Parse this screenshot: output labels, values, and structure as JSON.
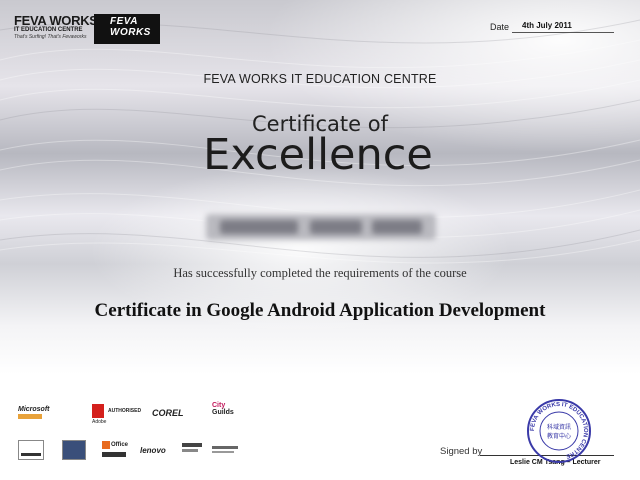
{
  "header": {
    "brand_name": "FEVA WORKS",
    "brand_sub": "IT EDUCATION CENTRE",
    "brand_tagline": "That's Surfing! That's Fevaworks",
    "brand_box_text": "FEVA WORKS"
  },
  "date": {
    "label": "Date",
    "value": "4th July 2011"
  },
  "certificate": {
    "centre_name": "FEVA WORKS IT EDUCATION CENTRE",
    "title_line1": "Certificate of",
    "title_line2": "Excellence",
    "completed_text": "Has successfully completed the requirements of the course",
    "course_name": "Certificate in Google Android Application Development"
  },
  "logos": {
    "microsoft": "Microsoft",
    "adobe": "Adobe",
    "adobe_authorised": "AUTHORISED",
    "corel": "COREL",
    "city_guilds_1": "City",
    "city_guilds_2": "Guilds",
    "lenovo": "lenovo",
    "office": "Office"
  },
  "signature": {
    "signed_by_label": "Signed by",
    "signer": "Leslie CM Tsang – Lecturer"
  },
  "stamp": {
    "ring_text": "FEVA WORKS IT EDUCATION CENTRE",
    "centre_chars": "科 域 資 訊 教 育 中 心"
  },
  "colors": {
    "stamp_blue": "#3a3aa8",
    "background_silver": "#cfd0d6"
  }
}
